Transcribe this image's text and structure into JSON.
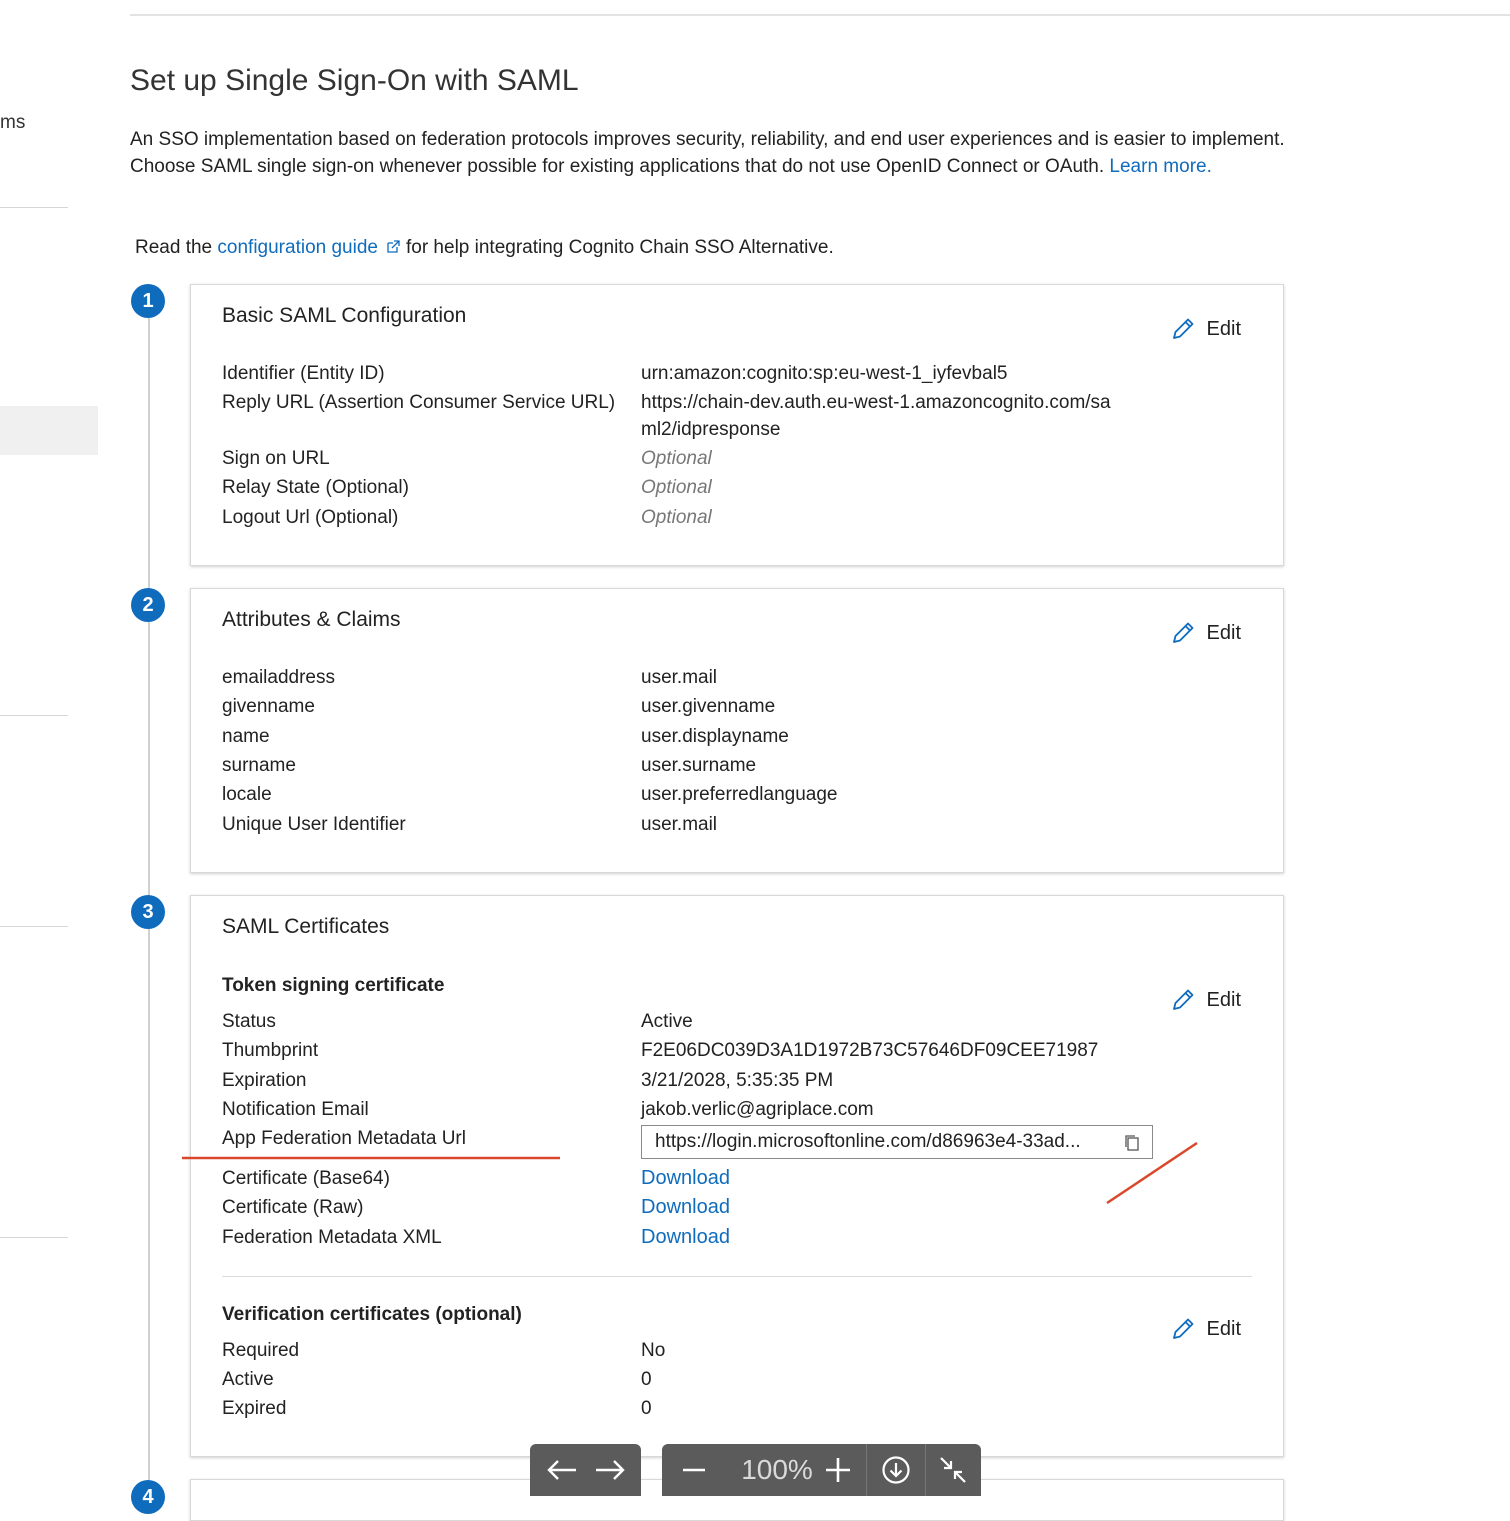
{
  "nav": {
    "partial_item": "ms"
  },
  "page": {
    "title": "Set up Single Sign-On with SAML",
    "intro_text": "An SSO implementation based on federation protocols improves security, reliability, and end user experiences and is easier to implement. Choose SAML single sign-on whenever possible for existing applications that do not use OpenID Connect or OAuth.",
    "learn_more": "Learn more.",
    "guide_prefix": "Read the",
    "guide_link": "configuration guide",
    "guide_suffix": "for help integrating Cognito Chain SSO Alternative."
  },
  "steps": [
    "1",
    "2",
    "3",
    "4"
  ],
  "edit_label": "Edit",
  "basic_saml": {
    "title": "Basic SAML Configuration",
    "rows": [
      {
        "label": "Identifier (Entity ID)",
        "value": "urn:amazon:cognito:sp:eu-west-1_iyfevbal5"
      },
      {
        "label": "Reply URL (Assertion Consumer Service URL)",
        "value": "https://chain-dev.auth.eu-west-1.amazoncognito.com/sa",
        "value2": "ml2/idpresponse"
      },
      {
        "label": "Sign on URL",
        "value": "Optional"
      },
      {
        "label": "Relay State (Optional)",
        "value": "Optional"
      },
      {
        "label": "Logout Url (Optional)",
        "value": "Optional"
      }
    ]
  },
  "attributes": {
    "title": "Attributes & Claims",
    "rows": [
      {
        "label": "emailaddress",
        "value": "user.mail"
      },
      {
        "label": "givenname",
        "value": "user.givenname"
      },
      {
        "label": "name",
        "value": "user.displayname"
      },
      {
        "label": "surname",
        "value": "user.surname"
      },
      {
        "label": "locale",
        "value": "user.preferredlanguage"
      },
      {
        "label": "Unique User Identifier",
        "value": "user.mail"
      }
    ]
  },
  "certificates": {
    "title": "SAML Certificates",
    "token_heading": "Token signing certificate",
    "rows": [
      {
        "label": "Status",
        "value": "Active"
      },
      {
        "label": "Thumbprint",
        "value": "F2E06DC039D3A1D1972B73C57646DF09CEE71987"
      },
      {
        "label": "Expiration",
        "value": "3/21/2028, 5:35:35 PM"
      },
      {
        "label": "Notification Email",
        "value": "jakob.verlic@agriplace.com"
      }
    ],
    "metadata_label": "App Federation Metadata Url",
    "metadata_url": "https://login.microsoftonline.com/d86963e4-33ad...",
    "downloads": [
      {
        "label": "Certificate (Base64)",
        "link": "Download"
      },
      {
        "label": "Certificate (Raw)",
        "link": "Download"
      },
      {
        "label": "Federation Metadata XML",
        "link": "Download"
      }
    ],
    "verification_heading": "Verification certificates (optional)",
    "verification_rows": [
      {
        "label": "Required",
        "value": "No"
      },
      {
        "label": "Active",
        "value": "0"
      },
      {
        "label": "Expired",
        "value": "0"
      }
    ]
  },
  "viewer_toolbar": {
    "zoom": "100%"
  },
  "annotation_color": "#d9482b",
  "accent_color": "#0f6cbd"
}
